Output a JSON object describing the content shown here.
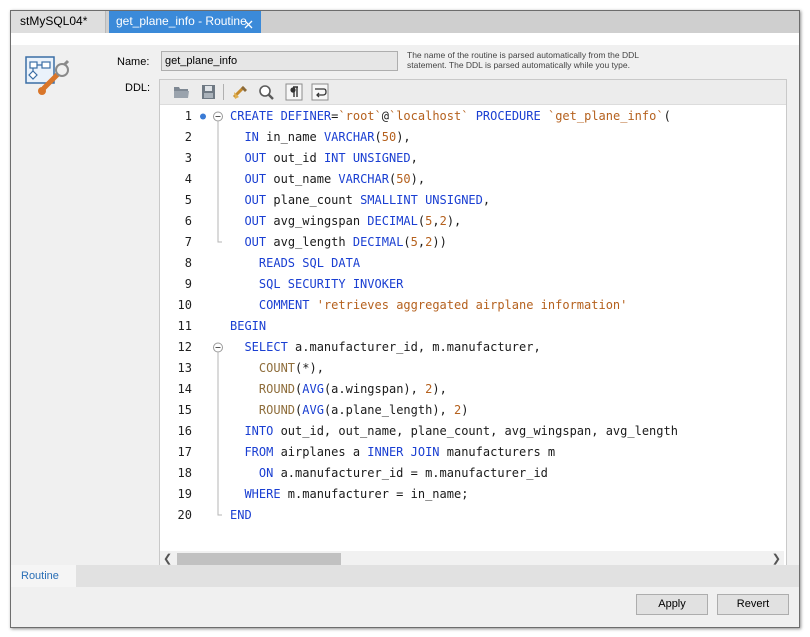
{
  "tabs": [
    {
      "label": "stMySQL04*"
    },
    {
      "label": "get_plane_info - Routine"
    }
  ],
  "form": {
    "name_label": "Name:",
    "name_value": "get_plane_info",
    "name_hint_line1": "The name of the routine is parsed automatically from the DDL",
    "name_hint_line2": "statement. The DDL is parsed automatically while you type.",
    "ddl_label": "DDL:"
  },
  "toolbar_icons": [
    "folder-open-icon",
    "save-icon",
    "beautify-icon",
    "search-icon",
    "pilcrow-icon",
    "word-wrap-icon"
  ],
  "code_lines": [
    {
      "n": "1",
      "t": [
        [
          "CREATE DEFINER",
          "kw"
        ],
        [
          "=",
          ""
        ],
        [
          "`root`",
          "str"
        ],
        [
          "@",
          ""
        ],
        [
          "`localhost`",
          "str"
        ],
        [
          " ",
          ""
        ],
        [
          "PROCEDURE",
          "kw"
        ],
        [
          " ",
          ""
        ],
        [
          "`get_plane_info`",
          "str"
        ],
        [
          "(",
          ""
        ]
      ]
    },
    {
      "n": "2",
      "t": [
        [
          "  ",
          ""
        ],
        [
          "IN",
          "kw"
        ],
        [
          " in_name ",
          ""
        ],
        [
          "VARCHAR",
          "kw"
        ],
        [
          "(",
          ""
        ],
        [
          "50",
          "num"
        ],
        [
          "),",
          ""
        ]
      ]
    },
    {
      "n": "3",
      "t": [
        [
          "  ",
          ""
        ],
        [
          "OUT",
          "kw"
        ],
        [
          " out_id ",
          ""
        ],
        [
          "INT UNSIGNED",
          "kw"
        ],
        [
          ",",
          ""
        ]
      ]
    },
    {
      "n": "4",
      "t": [
        [
          "  ",
          ""
        ],
        [
          "OUT",
          "kw"
        ],
        [
          " out_name ",
          ""
        ],
        [
          "VARCHAR",
          "kw"
        ],
        [
          "(",
          ""
        ],
        [
          "50",
          "num"
        ],
        [
          "),",
          ""
        ]
      ]
    },
    {
      "n": "5",
      "t": [
        [
          "  ",
          ""
        ],
        [
          "OUT",
          "kw"
        ],
        [
          " plane_count ",
          ""
        ],
        [
          "SMALLINT UNSIGNED",
          "kw"
        ],
        [
          ",",
          ""
        ]
      ]
    },
    {
      "n": "6",
      "t": [
        [
          "  ",
          ""
        ],
        [
          "OUT",
          "kw"
        ],
        [
          " avg_wingspan ",
          ""
        ],
        [
          "DECIMAL",
          "kw"
        ],
        [
          "(",
          ""
        ],
        [
          "5",
          "num"
        ],
        [
          ",",
          ""
        ],
        [
          "2",
          "num"
        ],
        [
          "),",
          ""
        ]
      ]
    },
    {
      "n": "7",
      "t": [
        [
          "  ",
          ""
        ],
        [
          "OUT",
          "kw"
        ],
        [
          " avg_length ",
          ""
        ],
        [
          "DECIMAL",
          "kw"
        ],
        [
          "(",
          ""
        ],
        [
          "5",
          "num"
        ],
        [
          ",",
          ""
        ],
        [
          "2",
          "num"
        ],
        [
          "))",
          ""
        ]
      ]
    },
    {
      "n": "8",
      "t": [
        [
          "    ",
          ""
        ],
        [
          "READS SQL DATA",
          "kw"
        ]
      ]
    },
    {
      "n": "9",
      "t": [
        [
          "    ",
          ""
        ],
        [
          "SQL SECURITY INVOKER",
          "kw"
        ]
      ]
    },
    {
      "n": "10",
      "t": [
        [
          "    ",
          ""
        ],
        [
          "COMMENT",
          "kw"
        ],
        [
          " ",
          ""
        ],
        [
          "'retrieves aggregated airplane information'",
          "str"
        ]
      ]
    },
    {
      "n": "11",
      "t": [
        [
          "BEGIN",
          "kw"
        ]
      ]
    },
    {
      "n": "12",
      "t": [
        [
          "  ",
          ""
        ],
        [
          "SELECT",
          "kw"
        ],
        [
          " a.manufacturer_id, m.manufacturer,",
          ""
        ]
      ]
    },
    {
      "n": "13",
      "t": [
        [
          "    ",
          ""
        ],
        [
          "COUNT",
          "fn"
        ],
        [
          "(*),",
          ""
        ]
      ]
    },
    {
      "n": "14",
      "t": [
        [
          "    ",
          ""
        ],
        [
          "ROUND",
          "fn"
        ],
        [
          "(",
          ""
        ],
        [
          "AVG",
          "kw"
        ],
        [
          "(a.wingspan), ",
          ""
        ],
        [
          "2",
          "num"
        ],
        [
          "),",
          ""
        ]
      ]
    },
    {
      "n": "15",
      "t": [
        [
          "    ",
          ""
        ],
        [
          "ROUND",
          "fn"
        ],
        [
          "(",
          ""
        ],
        [
          "AVG",
          "kw"
        ],
        [
          "(a.plane_length), ",
          ""
        ],
        [
          "2",
          "num"
        ],
        [
          ")",
          ""
        ]
      ]
    },
    {
      "n": "16",
      "t": [
        [
          "  ",
          ""
        ],
        [
          "INTO",
          "kw"
        ],
        [
          " out_id, out_name, plane_count, avg_wingspan, avg_length",
          ""
        ]
      ]
    },
    {
      "n": "17",
      "t": [
        [
          "  ",
          ""
        ],
        [
          "FROM",
          "kw"
        ],
        [
          " airplanes a ",
          ""
        ],
        [
          "INNER JOIN",
          "kw"
        ],
        [
          " manufacturers m",
          ""
        ]
      ]
    },
    {
      "n": "18",
      "t": [
        [
          "    ",
          ""
        ],
        [
          "ON",
          "kw"
        ],
        [
          " a.manufacturer_id = m.manufacturer_id",
          ""
        ]
      ]
    },
    {
      "n": "19",
      "t": [
        [
          "  ",
          ""
        ],
        [
          "WHERE",
          "kw"
        ],
        [
          " m.manufacturer = in_name;",
          ""
        ]
      ]
    },
    {
      "n": "20",
      "t": [
        [
          "END",
          "kw"
        ]
      ]
    }
  ],
  "bottom_tabs": [
    {
      "label": "Routine"
    }
  ],
  "buttons": {
    "apply": "Apply",
    "revert": "Revert"
  },
  "colors": {
    "accent_tab": "#3b8ad9",
    "keyword": "#1a3fd2",
    "string": "#b5611e",
    "function": "#8f6e3c"
  }
}
